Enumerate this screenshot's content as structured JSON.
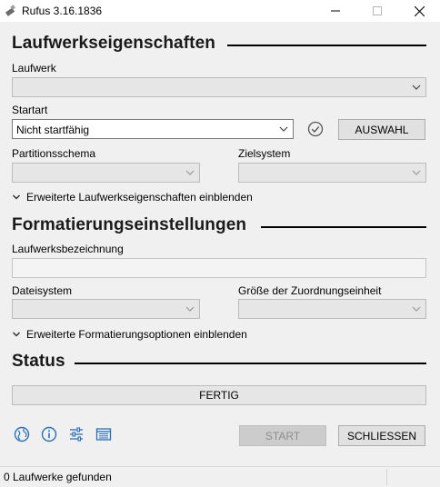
{
  "window": {
    "title": "Rufus 3.16.1836",
    "minimize_symbol": "—",
    "maximize_symbol": "☐",
    "close_symbol": "✕"
  },
  "drive_properties": {
    "section_title": "Laufwerkseigenschaften",
    "device_label": "Laufwerk",
    "device_value": "",
    "boot_selection_label": "Startart",
    "boot_selection_value": "Nicht startfähig",
    "select_button": "AUSWAHL",
    "partition_scheme_label": "Partitionsschema",
    "target_system_label": "Zielsystem",
    "advanced_toggle": "Erweiterte Laufwerkseigenschaften einblenden"
  },
  "format_options": {
    "section_title": "Formatierungseinstellungen",
    "volume_label_label": "Laufwerksbezeichnung",
    "volume_label_value": "",
    "file_system_label": "Dateisystem",
    "cluster_size_label": "Größe der Zuordnungseinheit",
    "advanced_toggle": "Erweiterte Formatierungsoptionen einblenden"
  },
  "status": {
    "section_title": "Status",
    "progress_text": "FERTIG",
    "progress_value": 0
  },
  "toolbar": {
    "icons": [
      "globe-icon",
      "info-icon",
      "settings-sliders-icon",
      "log-icon"
    ],
    "start_button": "START",
    "close_button": "SCHLIESSEN"
  },
  "statusbar": {
    "text": "0 Laufwerke gefunden"
  },
  "colors": {
    "icon_blue": "#2a6fb5",
    "background": "#f0f0f0"
  }
}
